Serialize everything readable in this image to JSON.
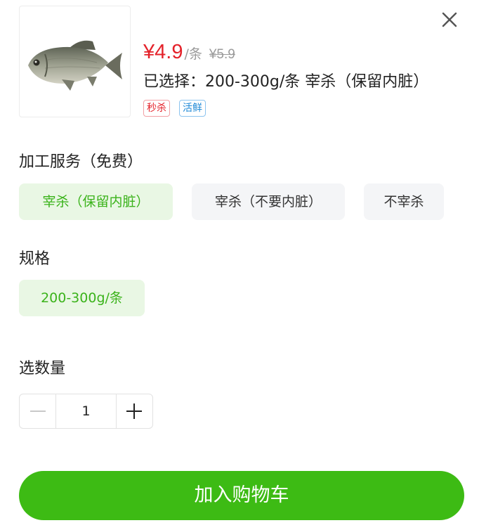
{
  "product": {
    "image_alt": "鲫鱼",
    "price": "¥4.9",
    "unit": "/条",
    "original_price": "¥5.9",
    "selected_text": "已选择：200-300g/条 宰杀（保留内脏）",
    "tags": [
      "秒杀",
      "活鲜"
    ]
  },
  "processing": {
    "title": "加工服务（免费）",
    "options": [
      "宰杀（保留内脏）",
      "宰杀（不要内脏）",
      "不宰杀"
    ],
    "selected_index": 0
  },
  "spec": {
    "title": "规格",
    "options": [
      "200-300g/条"
    ],
    "selected_index": 0
  },
  "quantity": {
    "title": "选数量",
    "value": "1"
  },
  "cart_button": {
    "label": "加入购物车"
  },
  "colors": {
    "accent": "#3dbb14",
    "price": "#e4222a",
    "chip_active_bg": "#e9f7e4",
    "chip_bg": "#f4f5f7"
  },
  "icons": [
    "close-icon",
    "minus-icon",
    "plus-icon"
  ]
}
